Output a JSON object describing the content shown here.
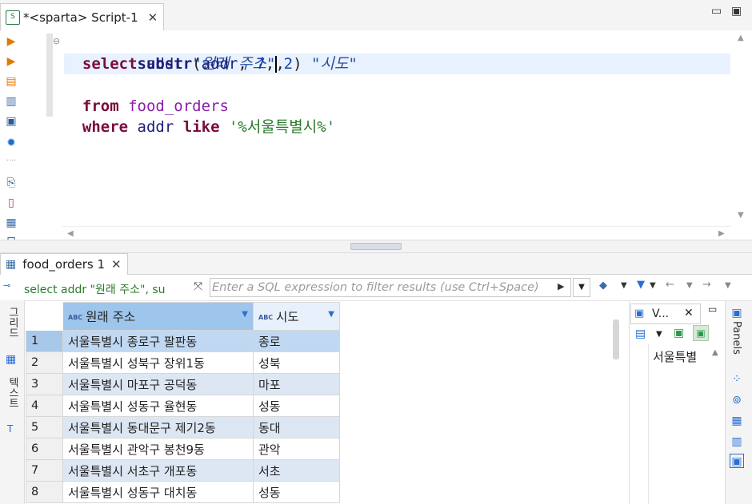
{
  "editor": {
    "tab_title": "*<sparta> Script-1",
    "tab_close": "✕",
    "minimize_icon": "minimize-icon",
    "maximize_icon": "maximize-icon"
  },
  "sql": {
    "line1": {
      "kw": "select",
      "ident": "addr",
      "alias": "\"원래 주소\"",
      "punct": ","
    },
    "line2": {
      "indent": "        ",
      "fn": "substr",
      "open": "(",
      "arg1": "addr",
      "comma1": ", ",
      "num1": "7",
      "comma2": ", ",
      "num2": "2",
      "close": ")",
      "alias": "\"시도\""
    },
    "line3": {
      "kw": "from",
      "table": "food_orders"
    },
    "line4": {
      "kw1": "where",
      "ident": "addr",
      "kw2": "like",
      "str": "'%서울특별시%'"
    }
  },
  "results": {
    "tab_title": "food_orders 1",
    "tab_close": "✕",
    "query_summary": "select addr \"원래 주소\", su",
    "filter_placeholder": "Enter a SQL expression to filter results (use Ctrl+Space)",
    "vtab_grid": "그리드",
    "vtab_text": "텍스트",
    "columns": [
      {
        "type": "ABC",
        "name": "원래 주소"
      },
      {
        "type": "ABC",
        "name": "시도"
      }
    ],
    "rows": [
      {
        "num": "1",
        "addr": "서울특별시 종로구 팔판동",
        "sido": "종로"
      },
      {
        "num": "2",
        "addr": "서울특별시 성북구 장위1동",
        "sido": "성북"
      },
      {
        "num": "3",
        "addr": "서울특별시 마포구 공덕동",
        "sido": "마포"
      },
      {
        "num": "4",
        "addr": "서울특별시 성동구 율현동",
        "sido": "성동"
      },
      {
        "num": "5",
        "addr": "서울특별시 동대문구 제기2동",
        "sido": "동대"
      },
      {
        "num": "6",
        "addr": "서울특별시 관악구 봉천9동",
        "sido": "관악"
      },
      {
        "num": "7",
        "addr": "서울특별시 서초구 개포동",
        "sido": "서초"
      },
      {
        "num": "8",
        "addr": "서울특별시 성동구 대치동",
        "sido": "성동"
      }
    ]
  },
  "value_panel": {
    "tab_title": "V...",
    "tab_close": "✕",
    "value": "서울특별"
  },
  "panels": {
    "label": "Panels"
  },
  "colors": {
    "keyword": "#7a0b3d",
    "string": "#2a7a2a",
    "selection": "#c0d8f1",
    "accent": "#2a6ed2"
  }
}
